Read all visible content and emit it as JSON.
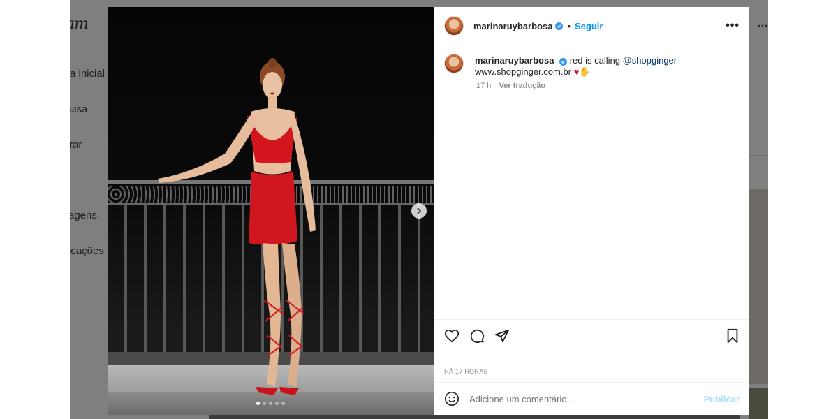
{
  "background": {
    "logo": "am",
    "nav": [
      "a inicial",
      "uisa",
      "rar",
      "agens",
      "icações"
    ]
  },
  "post": {
    "carousel_total": 5,
    "carousel_index": 1
  },
  "header": {
    "username": "marinaruybarbosa",
    "separator": "•",
    "follow_label": "Seguir",
    "more_label": "•••"
  },
  "caption": {
    "username": "marinaruybarbosa",
    "text": "red is calling",
    "mention": "@shopginger",
    "link": "www.shopginger.com.br",
    "emoji": "♥✋",
    "time": "17 h",
    "translate_label": "Ver tradução"
  },
  "footer": {
    "time_ago": "HÁ 17 HORAS",
    "comment_placeholder": "Adicione um comentário...",
    "publish_label": "Publicar"
  },
  "icons": {
    "like": "heart-icon",
    "comment": "comment-icon",
    "share": "send-icon",
    "save": "bookmark-icon",
    "emoji": "emoji-icon",
    "next": "chevron-right-icon",
    "verified": "verified-badge-icon"
  },
  "colors": {
    "link_blue": "#0095f6",
    "mention": "#00376b",
    "verified": "#3897f0",
    "muted": "#8e8e8e"
  }
}
